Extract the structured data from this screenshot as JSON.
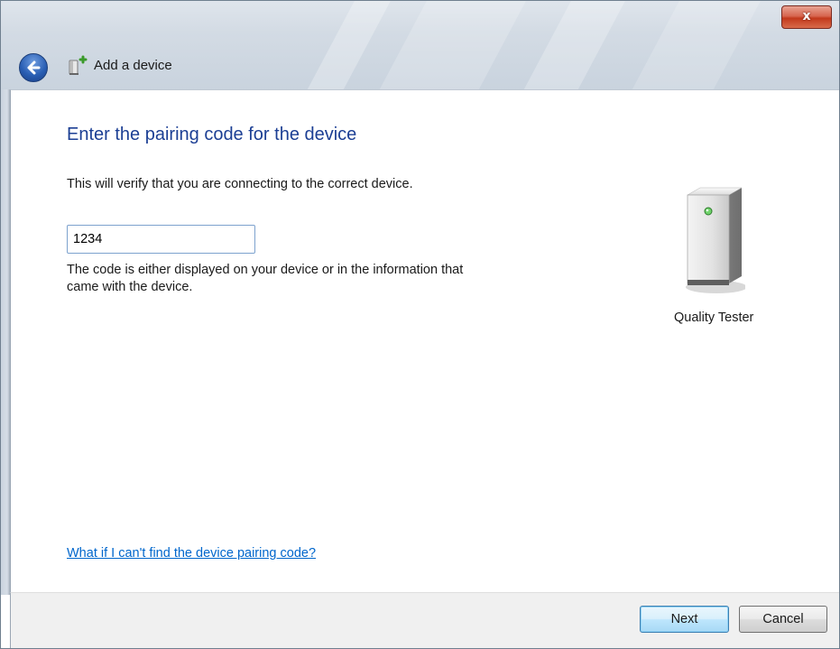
{
  "window": {
    "close_label": "x"
  },
  "header": {
    "title": "Add a device"
  },
  "main": {
    "heading": "Enter the pairing code for the device",
    "description": "This will verify that you are connecting to the correct device.",
    "code_value": "1234",
    "hint_line1": "The code is either displayed on your device or in the information that",
    "hint_line2": "came with the device.",
    "help_link": "What if I can't find the device pairing code?"
  },
  "device": {
    "name": "Quality Tester"
  },
  "footer": {
    "next_label": "Next",
    "cancel_label": "Cancel"
  },
  "colors": {
    "heading": "#1c3f94",
    "link": "#0066cc",
    "close_button": "#c2391c"
  },
  "icons": {
    "back": "back-arrow-icon",
    "header": "device-add-icon",
    "device": "computer-device-icon",
    "close": "close-icon"
  }
}
